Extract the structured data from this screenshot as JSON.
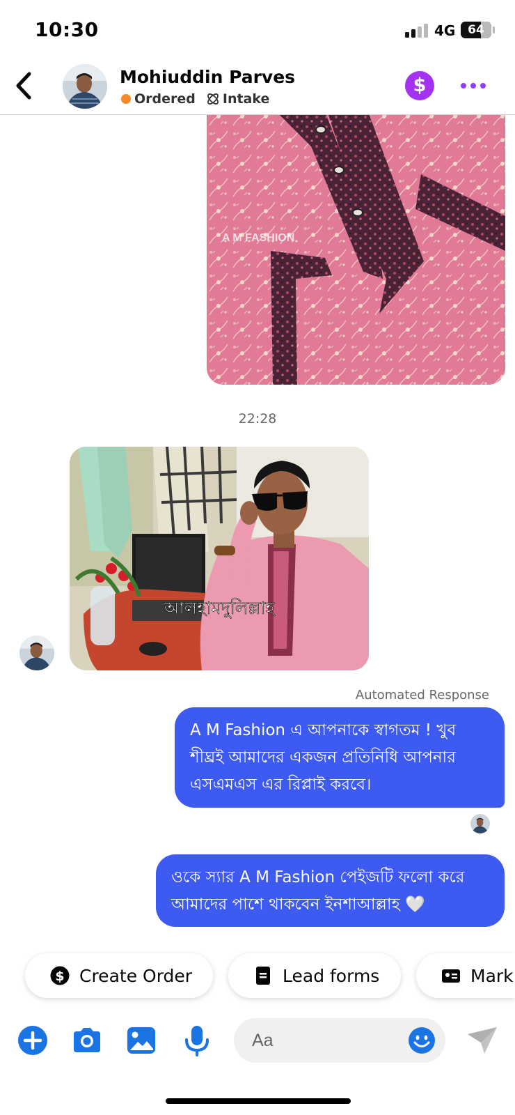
{
  "status_bar": {
    "time": "10:30",
    "network": "4G",
    "battery": "64"
  },
  "header": {
    "back_label": "Back",
    "contact_name": "Mohiuddin Parves",
    "tags": [
      "Ordered",
      "Intake"
    ],
    "tag_colors": {
      "ordered": "#f58a2a"
    },
    "payment_icon": "dollar-circle-icon",
    "payment_color": "#a333f0",
    "more_icon": "more-dots-icon",
    "accent_color": "#8a3ffc"
  },
  "chat": {
    "product_image": {
      "watermark": "A M FASHION"
    },
    "timestamp": "22:28",
    "customer_photo": {
      "caption": "আলহামদুলিল্লাহ"
    },
    "automated_label": "Automated Response",
    "messages": [
      {
        "lines": [
          "A M Fashion এ আপনাকে স্বাগতম ! খুব",
          "শীঘ্রই আমাদের একজন প্রতিনিধি আপনার",
          "এসএমএস এর রিপ্লাই করবে।"
        ]
      },
      {
        "lines": [
          "ওকে স্যার A M Fashion পেইজটি ফলো করে",
          "আমাদের পাশে থাকবেন ইনশাআল্লাহ 🤍"
        ]
      }
    ],
    "bubble_color": "#3d5af1"
  },
  "quick_replies": [
    "Create Order",
    "Lead forms",
    "Mark"
  ],
  "composer": {
    "placeholder": "Aa",
    "icons": [
      "plus-icon",
      "camera-icon",
      "gallery-icon",
      "microphone-icon",
      "emoji-icon",
      "send-icon"
    ],
    "icon_color": "#1b74e4"
  }
}
